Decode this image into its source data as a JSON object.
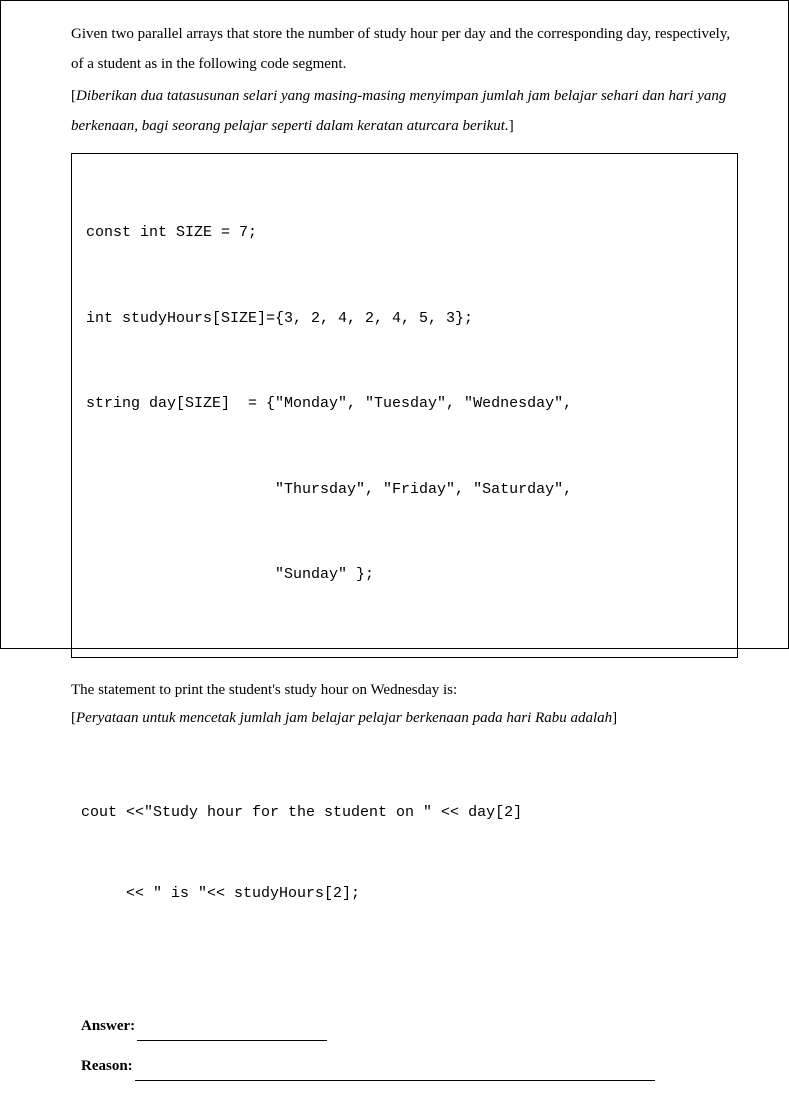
{
  "intro": {
    "en": "Given two parallel arrays that store the number of study hour per day and the corresponding day, respectively, of a student as in the following code segment.",
    "ms_open": "[",
    "ms": "Diberikan dua tatasusunan selari yang masing-masing menyimpan jumlah jam belajar sehari  dan hari yang berkenaan, bagi seorang pelajar seperti dalam keratan aturcara berikut.",
    "ms_close": "]"
  },
  "codebox": {
    "l1": "const int SIZE = 7;",
    "l2": "int studyHours[SIZE]={3, 2, 4, 2, 4, 5, 3};",
    "l3": "string day[SIZE]  = {\"Monday\", \"Tuesday\", \"Wednesday\",",
    "l4": "                     \"Thursday\", \"Friday\", \"Saturday\",",
    "l5": "                     \"Sunday\" };"
  },
  "statement": {
    "en": "The statement to print the student's study hour on Wednesday is:",
    "ms_open": "[",
    "ms": "Peryataan untuk mencetak jumlah jam belajar pelajar berkenaan pada hari Rabu adalah",
    "ms_close": "]"
  },
  "code_inline": {
    "l1": "cout <<\"Study hour for the student on \" << day[2]",
    "l2": "     << \" is \"<< studyHours[2];"
  },
  "answer_section": {
    "answer_label": "Answer:",
    "reason_label": "Reason:"
  }
}
